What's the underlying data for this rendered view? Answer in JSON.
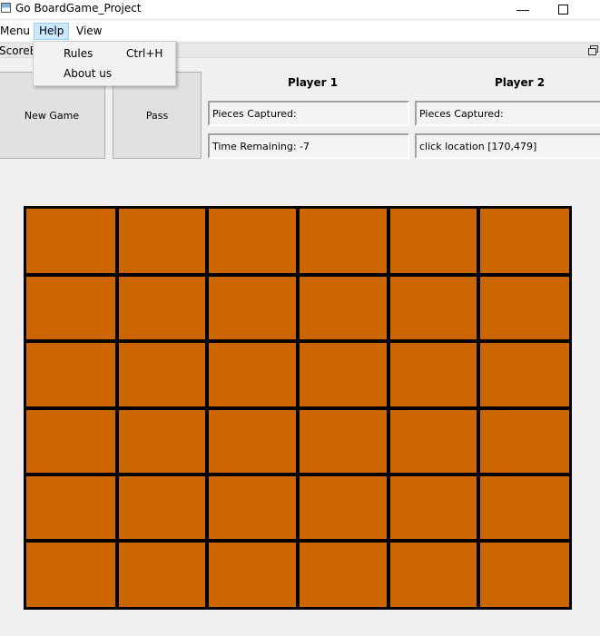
{
  "window": {
    "title": "Go BoardGame_Project",
    "minimize": "—"
  },
  "menubar": {
    "items": [
      "Menu",
      "Help",
      "View"
    ]
  },
  "help_menu": {
    "items": [
      {
        "label": "Rules",
        "shortcut": "Ctrl+H"
      },
      {
        "label": "About us",
        "shortcut": ""
      }
    ]
  },
  "dock": {
    "title": "ScoreBoard"
  },
  "buttons": {
    "new_game": "New Game",
    "pass": "Pass"
  },
  "players": [
    {
      "name": "Player 1",
      "line1": "Pieces Captured:",
      "line2": "Time Remaining: -7"
    },
    {
      "name": "Player 2",
      "line1": "Pieces Captured:",
      "line2": "click location [170,479]"
    }
  ],
  "board": {
    "rows": 6,
    "cols": 6,
    "cell_color": "#cc6600",
    "line_color": "#000000"
  }
}
